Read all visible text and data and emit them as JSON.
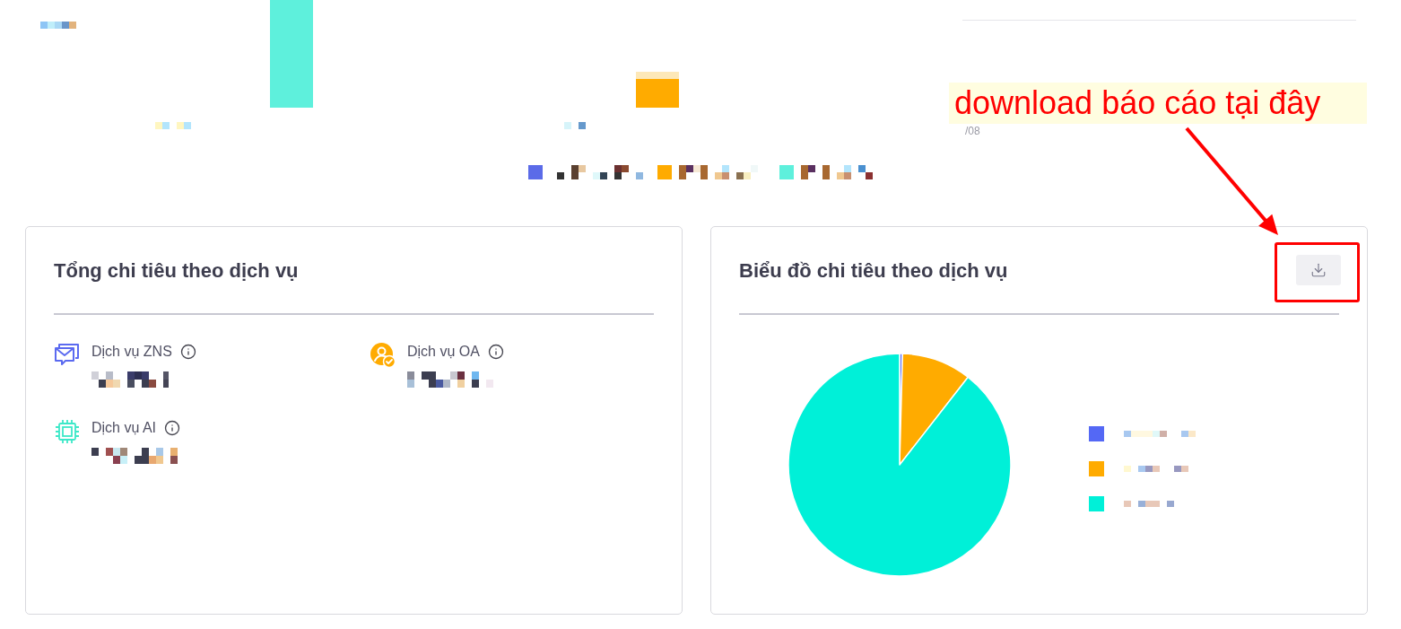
{
  "top_chart": {
    "legend": [
      {
        "color": "#5b6be8"
      },
      {
        "color": "#ffab00"
      },
      {
        "color": "#5ef0dc"
      }
    ],
    "axis_label": "/08"
  },
  "annotation": {
    "text": "download báo cáo tại đây"
  },
  "spending_card": {
    "title": "Tổng chi tiêu theo dịch vụ",
    "services": [
      {
        "kind": "zns",
        "label": "Dịch vụ ZNS"
      },
      {
        "kind": "oa",
        "label": "Dịch vụ OA"
      },
      {
        "kind": "ai",
        "label": "Dịch vụ AI"
      }
    ]
  },
  "chart_card": {
    "title": "Biểu đồ chi tiêu theo dịch vụ",
    "download_button": {
      "highlighted": true
    },
    "legend": [
      {
        "color": "#5468f5"
      },
      {
        "color": "#ffab00"
      },
      {
        "color": "#00f0d8"
      }
    ]
  }
}
